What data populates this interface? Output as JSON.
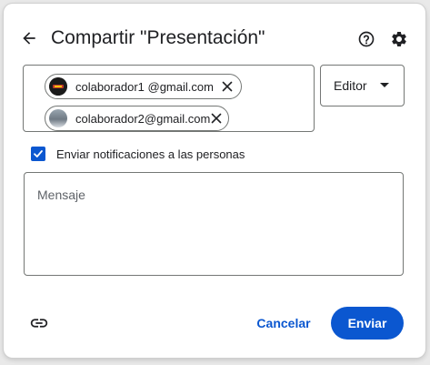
{
  "dialog": {
    "title": "Compartir \"Presentación\""
  },
  "header": {
    "back_icon": "arrow-left-icon",
    "help_icon": "help-circle-icon",
    "settings_icon": "gear-icon"
  },
  "recipients": [
    {
      "email": "colaborador1 @gmail.com",
      "avatar": "avatar-dark"
    },
    {
      "email": "colaborador2@gmail.com",
      "avatar": "avatar-photo"
    }
  ],
  "role": {
    "selected": "Editor"
  },
  "notify": {
    "checked": true,
    "label": "Enviar notificaciones a las personas"
  },
  "message": {
    "placeholder": "Mensaje",
    "value": ""
  },
  "footer": {
    "link_icon": "link-icon",
    "cancel_label": "Cancelar",
    "send_label": "Enviar"
  },
  "colors": {
    "accent": "#0b57d0",
    "text": "#202124",
    "border": "#747775"
  }
}
